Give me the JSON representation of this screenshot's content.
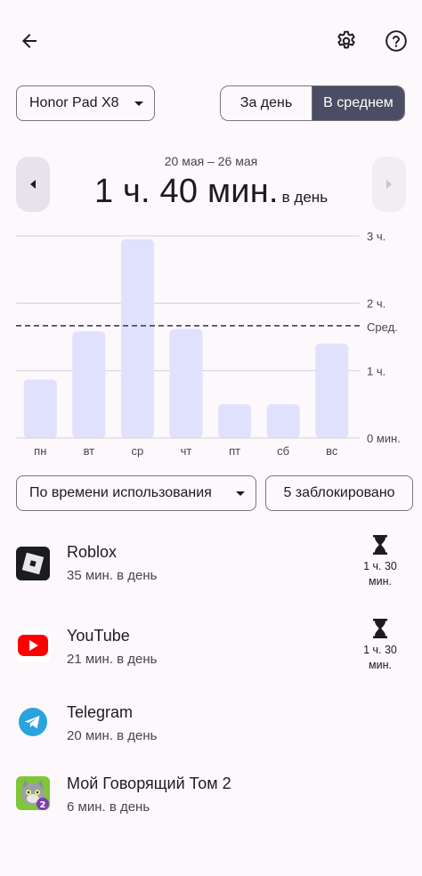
{
  "header": {
    "back_icon": "arrow-back-icon",
    "settings_icon": "gear-icon",
    "help_icon": "help-circle-icon"
  },
  "device": {
    "selected": "Honor Pad X8"
  },
  "view_toggle": {
    "day_label": "За день",
    "average_label": "В среднем",
    "selected": "В среднем"
  },
  "summary": {
    "date_range": "20 мая – 26 мая",
    "total": "1 ч. 40 мин.",
    "per_day_label": "в день"
  },
  "chart_data": {
    "type": "bar",
    "categories": [
      "пн",
      "вт",
      "ср",
      "чт",
      "пт",
      "сб",
      "вс"
    ],
    "values": [
      52,
      95,
      177,
      97,
      30,
      30,
      84
    ],
    "unit": "минуты",
    "ylim": [
      0,
      180
    ],
    "y_ticks": [
      {
        "value": 0,
        "label": "0 мин."
      },
      {
        "value": 60,
        "label": "1 ч."
      },
      {
        "value": 120,
        "label": "2 ч."
      },
      {
        "value": 180,
        "label": "3 ч."
      }
    ],
    "average": {
      "value": 100,
      "label": "Сред."
    },
    "colors": {
      "bar": "#e0e1fc",
      "grid": "#d4d0d8",
      "average_line": "#4a4d63",
      "tick_text": "#49454f"
    }
  },
  "filters": {
    "sort_selected": "По времени использования",
    "blocked_label": "5 заблокировано"
  },
  "apps": [
    {
      "name": "Roblox",
      "usage": "35 мин. в день",
      "icon": "roblox-icon",
      "limit": "1 ч. 30 мин."
    },
    {
      "name": "YouTube",
      "usage": "21 мин. в день",
      "icon": "youtube-icon",
      "limit": "1 ч. 30 мин."
    },
    {
      "name": "Telegram",
      "usage": "20 мин. в день",
      "icon": "telegram-icon"
    },
    {
      "name": "Мой Говорящий Том 2",
      "usage": "6 мин. в день",
      "icon": "talking-tom-2-icon"
    }
  ]
}
